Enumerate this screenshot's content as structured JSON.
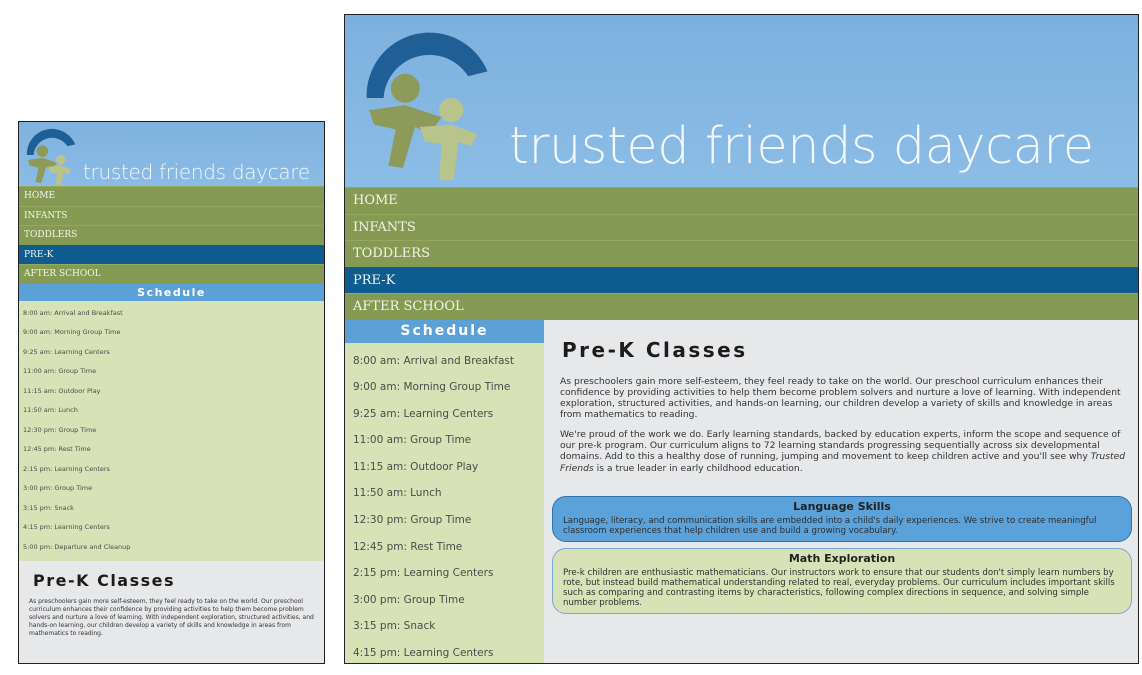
{
  "site": {
    "brand": "trusted friends daycare"
  },
  "colors": {
    "header_blue": "#8bbce6",
    "nav_green": "#859a52",
    "nav_active": "#0f5d90",
    "schedule_head": "#5ca0d8",
    "schedule_bg": "#d7e3b6",
    "logo_dark_blue": "#1f5f96",
    "logo_olive": "#8d9a5a",
    "logo_light_olive": "#b9c38c"
  },
  "nav": {
    "items": [
      {
        "label": "HOME"
      },
      {
        "label": "INFANTS"
      },
      {
        "label": "TODDLERS"
      },
      {
        "label": "PRE-K",
        "active": true
      },
      {
        "label": "AFTER SCHOOL"
      }
    ]
  },
  "schedule": {
    "title": "Schedule",
    "items": [
      "8:00 am: Arrival and Breakfast",
      "9:00 am: Morning Group Time",
      "9:25 am: Learning Centers",
      "11:00 am: Group Time",
      "11:15 am: Outdoor Play",
      "11:50 am: Lunch",
      "12:30 pm: Group Time",
      "12:45 pm: Rest Time",
      "2:15 pm: Learning Centers",
      "3:00 pm: Group Time",
      "3:15 pm: Snack",
      "4:15 pm: Learning Centers",
      "5:00 pm: Departure and Cleanup"
    ]
  },
  "main": {
    "title": "Pre-K Classes",
    "intro1": "As preschoolers gain more self-esteem, they feel ready to take on the world. Our preschool curriculum enhances their confidence by providing activities to help them become problem solvers and nurture a love of learning. With independent exploration, structured activities, and hands-on learning, our children develop a variety of skills and knowledge in areas from mathematics to reading.",
    "intro2_a": "We're proud of the work we do. Early learning standards, backed by education experts, inform the scope and sequence of our pre-k program. Our curriculum aligns to 72 learning standards progressing sequentially across six developmental domains. Add to this a healthy dose of running, jumping and movement to keep children active and you'll see why ",
    "intro2_em": "Trusted Friends",
    "intro2_b": " is a true leader in early childhood education.",
    "language": {
      "title": "Language Skills",
      "text": "Language, literacy, and communication skills are embedded into a child's daily experiences. We strive to create meaningful classroom experiences that help children use and build a growing vocabulary."
    },
    "math": {
      "title": "Math Exploration",
      "text": "Pre-k children are enthusiastic mathematicians. Our instructors work to ensure that our students don't simply learn numbers by rote, but instead build mathematical understanding related to real, everyday problems. Our curriculum includes important skills such as comparing and contrasting items by characteristics, following complex directions in sequence, and solving simple number problems."
    }
  }
}
